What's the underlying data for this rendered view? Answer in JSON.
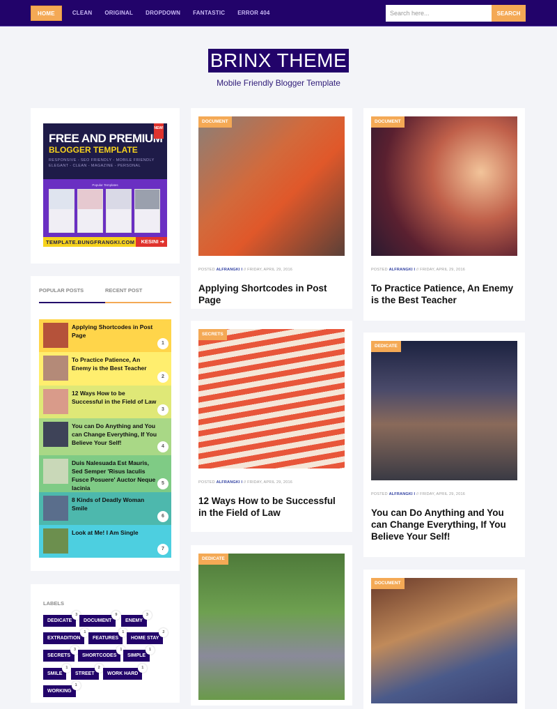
{
  "nav": {
    "items": [
      {
        "label": "HOME",
        "active": true
      },
      {
        "label": "CLEAN"
      },
      {
        "label": "ORIGINAL"
      },
      {
        "label": "DROPDOWN"
      },
      {
        "label": "FANTASTIC"
      },
      {
        "label": "ERROR 404"
      }
    ],
    "search_placeholder": "Search here...",
    "search_button": "SEARCH"
  },
  "header": {
    "title": "BRINX THEME",
    "tagline": "Mobile Friendly Blogger Template"
  },
  "banner": {
    "line1": "FREE AND PREMIUM",
    "line2": "BLOGGER TEMPLATE",
    "line3": "RESPONSIVE - SEO FRIENDLY - MOBILE FRIENDLY",
    "line4": "ELEGANT - CLEAN - MAGAZINE - PERSONAL",
    "ribbon": "NEW!",
    "popular": "Popular Templates",
    "url": "TEMPLATE.BUNGFRANGKI.COM",
    "cta": "KESINI ➔"
  },
  "sidebar_tabs": {
    "popular": "POPULAR POSTS",
    "recent": "RECENT POST"
  },
  "popular_posts": [
    {
      "title": "Applying Shortcodes in Post Page",
      "rank": "1",
      "bg": "#ffd54a",
      "thumb": "#b5523a"
    },
    {
      "title": "To Practice Patience, An Enemy is the Best Teacher",
      "rank": "2",
      "bg": "#ffee6e",
      "thumb": "#b48a78"
    },
    {
      "title": "12 Ways How to be Successful in the Field of Law",
      "rank": "3",
      "bg": "#dfe877",
      "thumb": "#d99b8a"
    },
    {
      "title": "You can Do Anything and You can Change Everything, If You Believe Your Self!",
      "rank": "4",
      "bg": "#a9d886",
      "thumb": "#3e4358"
    },
    {
      "title": "Duis Nalesuada Est Mauris, Sed Semper 'Risus Iaculis Fusce Posuere' Auctor Neque lacinia",
      "rank": "5",
      "bg": "#7fcb85",
      "thumb": "#c9d8b8"
    },
    {
      "title": "8 Kinds of Deadly Woman Smile",
      "rank": "6",
      "bg": "#4db8ad",
      "thumb": "#5a6e8c"
    },
    {
      "title": "Look at Me! I Am Single",
      "rank": "7",
      "bg": "#4dcfe0",
      "thumb": "#6c8f4e"
    }
  ],
  "labels": {
    "title": "LABELS",
    "items": [
      {
        "name": "DEDICATE",
        "count": "3"
      },
      {
        "name": "DOCUMENT",
        "count": "9"
      },
      {
        "name": "ENEMY",
        "count": "3"
      },
      {
        "name": "EXTRADITION",
        "count": "1"
      },
      {
        "name": "FEATURES",
        "count": "1"
      },
      {
        "name": "HOME STAY",
        "count": "2"
      },
      {
        "name": "SECRETS",
        "count": "3"
      },
      {
        "name": "SHORTCODES",
        "count": "1"
      },
      {
        "name": "SIMPLE",
        "count": "1"
      },
      {
        "name": "SMILE",
        "count": "1"
      },
      {
        "name": "STREET",
        "count": "2"
      },
      {
        "name": "WORK HARD",
        "count": "1"
      },
      {
        "name": "WORKING",
        "count": "1"
      }
    ]
  },
  "posts": [
    {
      "tag": "DOCUMENT",
      "posted": "POSTED",
      "author": "ALFRANGKI I",
      "date": "// FRIDAY, APRIL 29, 2016",
      "title": "Applying Shortcodes in Post Page",
      "img": "linear-gradient(135deg,#8a7f78 0%,#d26a3c 40%,#e0582a 60%,#5a4038 100%)"
    },
    {
      "tag": "DOCUMENT",
      "posted": "POSTED",
      "author": "ALFRANGKI I",
      "date": "// FRIDAY, APRIL 29, 2016",
      "title": "To Practice Patience, An Enemy is the Best Teacher",
      "img": "radial-gradient(circle at 75% 40%,#f2c49a 0%,#c0604a 35%,#5a2030 70%,#2a1a30 100%)"
    },
    {
      "tag": "SECRETS",
      "posted": "POSTED",
      "author": "ALFRANGKI I",
      "date": "// FRIDAY, APRIL 29, 2016",
      "title": "12 Ways How to be Successful in the Field of Law",
      "img": "repeating-linear-gradient(170deg,#e8563a 0px,#e8563a 8px,#f5e6d8 8px,#f5e6d8 16px)"
    },
    {
      "tag": "DEDICATE",
      "posted": "POSTED",
      "author": "ALFRANGKI I",
      "date": "// FRIDAY, APRIL 29, 2016",
      "title": "You can Do Anything and You can Change Everything, If You Believe Your Self!",
      "img": "linear-gradient(180deg,#1c2240 0%,#4a4a6a 35%,#8a6a5a 60%,#3a3a44 100%)"
    },
    {
      "tag": "DEDICATE",
      "img": "linear-gradient(180deg,#4e7a3a 0%,#6ea050 40%,#8a8a9a 70%,#6a9a4a 100%)"
    },
    {
      "tag": "DOCUMENT",
      "img": "linear-gradient(160deg,#6a3a2a 0%,#c08a5a 40%,#4a5a8a 70%,#3a4070 100%)"
    }
  ]
}
